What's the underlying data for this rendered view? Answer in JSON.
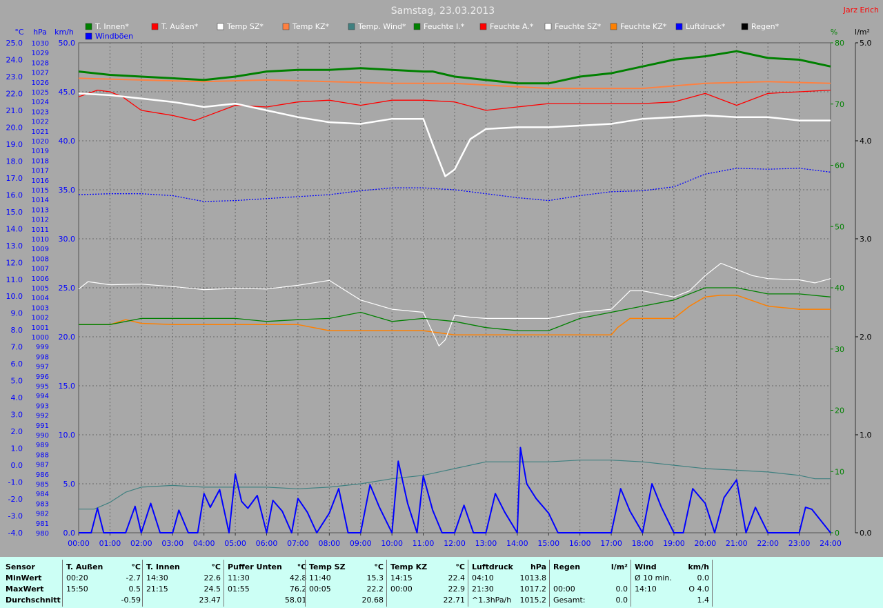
{
  "title": "Samstag, 23.03.2013",
  "author": "Jarz Erich",
  "axis_units": {
    "temp": "°C",
    "pressure": "hPa",
    "wind": "km/h",
    "humidity": "%",
    "rain": "l/m²"
  },
  "temp_ticks": [
    "25.0",
    "24.0",
    "23.0",
    "22.0",
    "21.0",
    "20.0",
    "19.0",
    "18.0",
    "17.0",
    "16.0",
    "15.0",
    "14.0",
    "13.0",
    "12.0",
    "11.0",
    "10.0",
    "9.0",
    "8.0",
    "7.0",
    "6.0",
    "5.0",
    "4.0",
    "3.0",
    "2.0",
    "1.0",
    "0.0",
    "-1.0",
    "-2.0",
    "-3.0",
    "-4.0"
  ],
  "pressure_ticks": [
    "1030",
    "1029",
    "1028",
    "1027",
    "1026",
    "1025",
    "1024",
    "1023",
    "1022",
    "1021",
    "1020",
    "1019",
    "1018",
    "1017",
    "1016",
    "1015",
    "1014",
    "1013",
    "1012",
    "1011",
    "1010",
    "1009",
    "1008",
    "1007",
    "1006",
    "1005",
    "1004",
    "1003",
    "1002",
    "1001",
    "1000",
    "999",
    "998",
    "997",
    "996",
    "995",
    "994",
    "993",
    "992",
    "991",
    "990",
    "989",
    "988",
    "987",
    "986",
    "985",
    "984",
    "983",
    "982",
    "981",
    "980"
  ],
  "wind_ticks": [
    "50.0",
    "45.0",
    "40.0",
    "35.0",
    "30.0",
    "25.0",
    "20.0",
    "15.0",
    "10.0",
    "5.0",
    "0.0"
  ],
  "humidity_ticks": [
    "80",
    "70",
    "60",
    "50",
    "40",
    "30",
    "20",
    "10",
    "0"
  ],
  "rain_ticks": [
    "5.0",
    "4.0",
    "3.0",
    "2.0",
    "1.0",
    "0.0"
  ],
  "time_ticks": [
    "00:00",
    "01:00",
    "02:00",
    "03:00",
    "04:00",
    "05:00",
    "06:00",
    "07:00",
    "08:00",
    "09:00",
    "10:00",
    "11:00",
    "12:00",
    "13:00",
    "14:00",
    "15:00",
    "16:00",
    "17:00",
    "18:00",
    "19:00",
    "20:00",
    "21:00",
    "22:00",
    "23:00",
    "24:00"
  ],
  "legend": [
    {
      "label": "T. Innen*",
      "color": "#008000"
    },
    {
      "label": "T. Außen*",
      "color": "#ff0000"
    },
    {
      "label": "Temp SZ*",
      "color": "#ffffff"
    },
    {
      "label": "Temp KZ*",
      "color": "#ff8040"
    },
    {
      "label": "Temp. Wind*",
      "color": "#408080"
    },
    {
      "label": "Feuchte I.*",
      "color": "#008000"
    },
    {
      "label": "Feuchte A.*",
      "color": "#ff0000"
    },
    {
      "label": "Feuchte SZ*",
      "color": "#ffffff"
    },
    {
      "label": "Feuchte KZ*",
      "color": "#ff8000"
    },
    {
      "label": "Luftdruck*",
      "color": "#0000ff"
    },
    {
      "label": "Regen*",
      "color": "#000000"
    },
    {
      "label": "Windböen",
      "color": "#0000ff"
    }
  ],
  "chart_data": {
    "type": "line",
    "x_unit": "hours",
    "grid": true,
    "series": [
      {
        "name": "T. Innen",
        "axis": "temp_c",
        "color": "#008000",
        "x": [
          0,
          1,
          2,
          3,
          4,
          5,
          6,
          7,
          8,
          9,
          10,
          11,
          11.3,
          12,
          13,
          14,
          15,
          16,
          17,
          18,
          19,
          20,
          21,
          22,
          23,
          24
        ],
        "y": [
          23.3,
          23.1,
          23.0,
          22.9,
          22.8,
          23.0,
          23.3,
          23.4,
          23.4,
          23.5,
          23.4,
          23.3,
          23.3,
          23.0,
          22.8,
          22.6,
          22.6,
          23.0,
          23.2,
          23.6,
          24.0,
          24.2,
          24.5,
          24.1,
          24.0,
          23.6
        ]
      },
      {
        "name": "T. Außen",
        "axis": "temp_c",
        "color": "#ff0000",
        "x": [
          0,
          0.6,
          1,
          1.4,
          2,
          3,
          3.7,
          4,
          5,
          6,
          7,
          8,
          9,
          10,
          11,
          12,
          13,
          14,
          15,
          16,
          17,
          18,
          19,
          20,
          21,
          22,
          23,
          24
        ],
        "y": [
          21.8,
          22.2,
          22.1,
          21.8,
          21.0,
          20.7,
          20.4,
          20.6,
          21.3,
          21.2,
          21.5,
          21.6,
          21.3,
          21.6,
          21.6,
          21.5,
          21.0,
          21.2,
          21.4,
          21.4,
          21.4,
          21.4,
          21.5,
          22.0,
          21.3,
          22.0,
          22.1,
          22.2
        ]
      },
      {
        "name": "Temp SZ",
        "axis": "temp_c",
        "color": "#ffffff",
        "x": [
          0,
          1,
          2,
          3,
          4,
          5,
          6,
          7,
          8,
          9,
          10,
          11,
          11.3,
          11.7,
          12,
          12.5,
          13,
          14,
          15,
          16,
          17,
          18,
          19,
          20,
          21,
          22,
          23,
          24
        ],
        "y": [
          22.0,
          21.9,
          21.7,
          21.5,
          21.2,
          21.4,
          21.0,
          20.6,
          20.3,
          20.2,
          20.5,
          20.5,
          19.0,
          17.1,
          17.5,
          19.3,
          19.9,
          20.0,
          20.0,
          20.1,
          20.2,
          20.5,
          20.6,
          20.7,
          20.6,
          20.6,
          20.4,
          20.4
        ]
      },
      {
        "name": "Temp KZ",
        "axis": "temp_c",
        "color": "#ff8040",
        "x": [
          0,
          2,
          4,
          6,
          8,
          10,
          12,
          14,
          15,
          16,
          18,
          20,
          22,
          24
        ],
        "y": [
          22.9,
          22.8,
          22.7,
          22.8,
          22.7,
          22.6,
          22.6,
          22.4,
          22.3,
          22.3,
          22.3,
          22.6,
          22.7,
          22.6
        ]
      },
      {
        "name": "Temp. Wind",
        "axis": "temp_c",
        "color": "#408080",
        "x": [
          0,
          0.5,
          1,
          1.5,
          2,
          3,
          4,
          5,
          6,
          7,
          8,
          9,
          10,
          11,
          12,
          13,
          14,
          15,
          16,
          17,
          18,
          19,
          20,
          21,
          22,
          23,
          23.5,
          24
        ],
        "y": [
          -2.6,
          -2.6,
          -2.2,
          -1.6,
          -1.3,
          -1.2,
          -1.3,
          -1.3,
          -1.3,
          -1.4,
          -1.3,
          -1.1,
          -0.8,
          -0.6,
          -0.2,
          0.2,
          0.2,
          0.2,
          0.3,
          0.3,
          0.2,
          0.0,
          -0.2,
          -0.3,
          -0.4,
          -0.6,
          -0.8,
          -0.8
        ]
      },
      {
        "name": "Luftdruck",
        "axis": "pressure_hpa",
        "color": "#0000ff",
        "x": [
          0,
          1,
          2,
          3,
          4,
          5,
          6,
          7,
          8,
          9,
          10,
          11,
          12,
          13,
          14,
          15,
          16,
          17,
          18,
          19,
          20,
          21,
          22,
          23,
          24
        ],
        "y": [
          1014.5,
          1014.6,
          1014.6,
          1014.4,
          1013.8,
          1013.9,
          1014.1,
          1014.3,
          1014.5,
          1014.9,
          1015.2,
          1015.2,
          1015.0,
          1014.6,
          1014.2,
          1013.9,
          1014.4,
          1014.8,
          1014.9,
          1015.3,
          1016.6,
          1017.2,
          1017.1,
          1017.2,
          1016.8
        ]
      },
      {
        "name": "Windböen",
        "axis": "wind_kmh",
        "color": "#0000ff",
        "x": [
          0,
          0.4,
          0.6,
          0.8,
          1,
          1.5,
          1.8,
          2,
          2.3,
          2.6,
          3,
          3.2,
          3.5,
          3.8,
          4,
          4.2,
          4.5,
          4.8,
          5,
          5.2,
          5.4,
          5.7,
          6,
          6.2,
          6.5,
          6.8,
          7,
          7.3,
          7.6,
          8,
          8.3,
          8.6,
          9,
          9.3,
          9.6,
          10,
          10.2,
          10.5,
          10.8,
          11,
          11.3,
          11.6,
          12,
          12.3,
          12.6,
          13,
          13.3,
          13.6,
          14,
          14.1,
          14.3,
          14.6,
          15,
          15.3,
          15.6,
          16,
          16.3,
          16.6,
          17,
          17.3,
          17.6,
          18,
          18.3,
          18.6,
          19,
          19.3,
          19.6,
          20,
          20.3,
          20.6,
          21,
          21.3,
          21.6,
          22,
          22.5,
          23,
          23.2,
          23.4,
          24
        ],
        "y": [
          0,
          0,
          2.5,
          0,
          0,
          0,
          2.7,
          0,
          3.0,
          0,
          0,
          2.3,
          0,
          0,
          4.0,
          2.6,
          4.4,
          0,
          6.0,
          3.2,
          2.5,
          3.8,
          0,
          3.3,
          2.2,
          0,
          3.5,
          2.1,
          0,
          2.0,
          4.5,
          0,
          0,
          4.9,
          2.6,
          0,
          7.3,
          3.0,
          0,
          5.8,
          2.3,
          0,
          0,
          2.8,
          0,
          0,
          4.0,
          2.1,
          0,
          8.7,
          5.0,
          3.5,
          2.0,
          0,
          0,
          0,
          0,
          0,
          0,
          4.5,
          2.2,
          0,
          5.0,
          2.6,
          0,
          0,
          4.5,
          3.0,
          0,
          3.6,
          5.4,
          0,
          2.6,
          0,
          0,
          0,
          2.6,
          2.4,
          0
        ]
      },
      {
        "name": "Feuchte I.",
        "axis": "humidity_pct",
        "color": "#008000",
        "x": [
          0,
          1,
          2,
          3,
          4,
          5,
          6,
          7,
          8,
          9,
          10,
          11,
          12,
          13,
          14,
          15,
          16,
          17,
          18,
          19,
          20,
          21,
          22,
          23,
          24
        ],
        "y": [
          34.0,
          34.0,
          35.0,
          35.0,
          35.0,
          35.0,
          34.5,
          34.8,
          35.0,
          36.0,
          34.5,
          35.0,
          34.5,
          33.5,
          33.0,
          33.0,
          35.0,
          36.0,
          37.0,
          38.0,
          40.0,
          40.0,
          39.0,
          39.0,
          38.5
        ]
      },
      {
        "name": "Feuchte A.",
        "axis": "humidity_pct",
        "color": "#ff0000",
        "x": [
          0,
          1,
          2,
          3,
          4,
          5,
          6,
          7,
          8,
          9,
          10,
          11,
          12,
          13,
          14,
          15,
          16,
          17,
          18,
          19,
          20,
          21,
          22,
          23,
          24
        ],
        "y": [
          null,
          null,
          null,
          null,
          null,
          null,
          null,
          null,
          null,
          null,
          null,
          null,
          null,
          null,
          null,
          null,
          null,
          null,
          null,
          null,
          null,
          null,
          null,
          null,
          null
        ]
      },
      {
        "name": "Feuchte SZ",
        "axis": "humidity_pct",
        "color": "#ffffff",
        "x": [
          0,
          0.3,
          1,
          2,
          3,
          4,
          5,
          6,
          7,
          8,
          9,
          10,
          11,
          11.5,
          11.7,
          12,
          12.5,
          13,
          14,
          15,
          16,
          17,
          17.3,
          17.6,
          18,
          19,
          19.5,
          20,
          20.5,
          21,
          21.5,
          22,
          23,
          23.5,
          24
        ],
        "y": [
          39.8,
          41.0,
          40.5,
          40.6,
          40.2,
          39.7,
          39.9,
          39.8,
          40.4,
          41.2,
          38.0,
          36.5,
          36.0,
          30.5,
          31.5,
          35.5,
          35.2,
          35.0,
          35.0,
          35.0,
          36.0,
          36.5,
          38.0,
          39.5,
          39.5,
          38.5,
          39.5,
          42.0,
          44.0,
          43.0,
          42.0,
          41.5,
          41.3,
          40.8,
          41.5
        ]
      },
      {
        "name": "Feuchte KZ",
        "axis": "humidity_pct",
        "color": "#ff8000",
        "x": [
          0,
          1,
          1.5,
          2,
          3,
          4,
          5,
          6,
          7,
          8,
          9,
          10,
          11,
          12,
          13,
          14,
          15,
          16,
          17,
          17.2,
          17.6,
          18,
          19,
          19.5,
          20,
          20.5,
          21,
          22,
          23,
          24
        ],
        "y": [
          34.0,
          34.0,
          34.8,
          34.2,
          34.0,
          34.0,
          34.0,
          34.0,
          34.0,
          33.0,
          33.0,
          33.0,
          33.0,
          32.3,
          32.3,
          32.3,
          32.3,
          32.3,
          32.3,
          33.5,
          35.0,
          35.0,
          35.0,
          37.0,
          38.5,
          38.8,
          38.8,
          37.0,
          36.5,
          36.5
        ]
      },
      {
        "name": "Regen",
        "axis": "rain_lm2",
        "color": "#000000",
        "x": [
          0,
          24
        ],
        "y": [
          0,
          0
        ]
      }
    ],
    "axes": {
      "temp_c": {
        "label": "°C",
        "ylim": [
          -4,
          25
        ]
      },
      "pressure_hpa": {
        "label": "hPa",
        "ylim": [
          980,
          1030
        ]
      },
      "wind_kmh": {
        "label": "km/h",
        "ylim": [
          0,
          50
        ]
      },
      "humidity_pct": {
        "label": "%",
        "ylim": [
          0,
          80
        ]
      },
      "rain_lm2": {
        "label": "l/m²",
        "ylim": [
          0,
          5
        ]
      }
    },
    "xlim": [
      0,
      24
    ]
  },
  "stats": {
    "row_labels": [
      "Sensor",
      "MinWert",
      "MaxWert",
      "Durchschnitt"
    ],
    "columns": [
      {
        "name": "T. Außen",
        "unit": "°C",
        "rows": [
          [
            "00:20",
            "-2.7"
          ],
          [
            "15:50",
            "0.5"
          ],
          [
            "",
            "-0.59"
          ]
        ]
      },
      {
        "name": "T. Innen",
        "unit": "°C",
        "rows": [
          [
            "14:30",
            "22.6"
          ],
          [
            "21:15",
            "24.5"
          ],
          [
            "",
            "23.47"
          ]
        ]
      },
      {
        "name": "Puffer Unten",
        "unit": "°C",
        "rows": [
          [
            "11:30",
            "42.8"
          ],
          [
            "01:55",
            "76.2"
          ],
          [
            "",
            "58.01"
          ]
        ]
      },
      {
        "name": "Temp SZ",
        "unit": "°C",
        "rows": [
          [
            "11:40",
            "15.3"
          ],
          [
            "00:05",
            "22.2"
          ],
          [
            "",
            "20.68"
          ]
        ]
      },
      {
        "name": "Temp KZ",
        "unit": "°C",
        "rows": [
          [
            "14:15",
            "22.4"
          ],
          [
            "00:00",
            "22.9"
          ],
          [
            "",
            "22.71"
          ]
        ]
      },
      {
        "name": "Luftdruck",
        "unit": "hPa",
        "rows": [
          [
            "04:10",
            "1013.8"
          ],
          [
            "21:30",
            "1017.2"
          ],
          [
            "^1.3hPa/h",
            "1015.2"
          ]
        ]
      },
      {
        "name": "Regen",
        "unit": "l/m²",
        "rows": [
          [
            "",
            ""
          ],
          [
            "00:00",
            "0.0"
          ],
          [
            "Gesamt:",
            "0.0"
          ]
        ]
      },
      {
        "name": "Wind",
        "unit": "km/h",
        "rows": [
          [
            "Ø 10 min.",
            "0.0"
          ],
          [
            "14:10",
            "O 4.0"
          ],
          [
            "",
            "1.4"
          ]
        ]
      }
    ]
  }
}
